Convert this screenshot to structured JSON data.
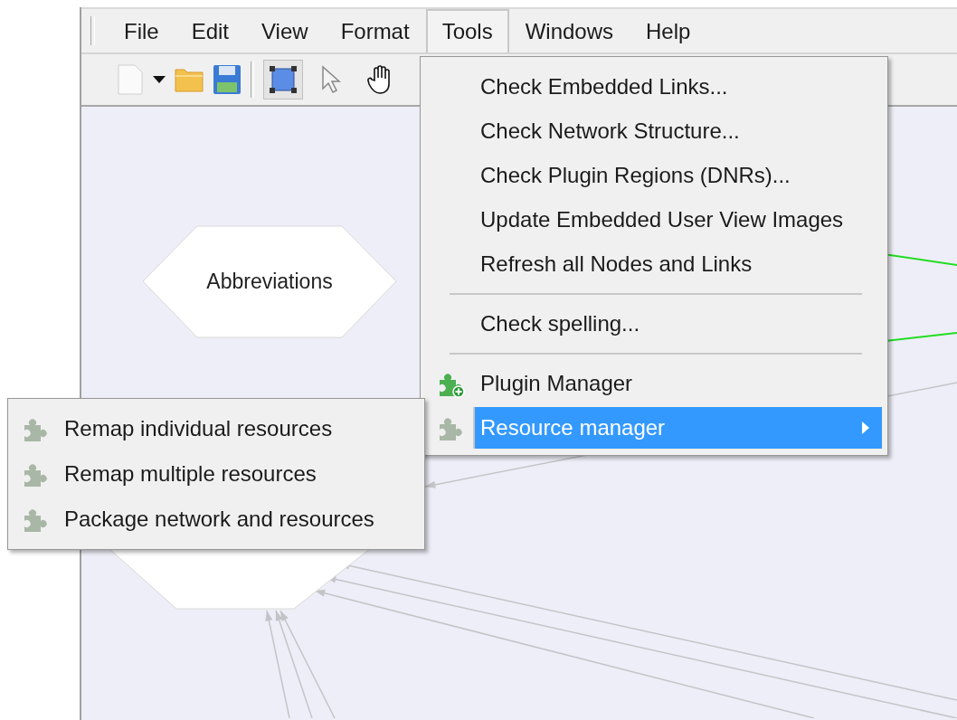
{
  "menubar": [
    {
      "label": "File",
      "selected": false
    },
    {
      "label": "Edit",
      "selected": false
    },
    {
      "label": "View",
      "selected": false
    },
    {
      "label": "Format",
      "selected": false
    },
    {
      "label": "Tools",
      "selected": true
    },
    {
      "label": "Windows",
      "selected": false
    },
    {
      "label": "Help",
      "selected": false
    }
  ],
  "toolbar": [
    {
      "kind": "new"
    },
    {
      "kind": "caret"
    },
    {
      "kind": "open"
    },
    {
      "kind": "save"
    },
    {
      "kind": "separator"
    },
    {
      "kind": "rect-select",
      "selected": true
    },
    {
      "kind": "pointer",
      "selected": false
    },
    {
      "kind": "hand",
      "selected": false
    }
  ],
  "canvas": {
    "nodes": [
      {
        "label": "Abbreviations",
        "kind": "hexagon"
      }
    ]
  },
  "tools_menu": [
    {
      "kind": "item",
      "label": "Check Embedded Links...",
      "selected": false
    },
    {
      "kind": "item",
      "label": "Check Network Structure...",
      "selected": false
    },
    {
      "kind": "item",
      "label": "Check Plugin Regions (DNRs)...",
      "selected": false
    },
    {
      "kind": "item",
      "label": "Update Embedded User View Images",
      "selected": false
    },
    {
      "kind": "item",
      "label": "Refresh all Nodes and Links",
      "selected": false
    },
    {
      "kind": "separator"
    },
    {
      "kind": "item",
      "label": "Check spelling...",
      "selected": false
    },
    {
      "kind": "separator"
    },
    {
      "kind": "plugin",
      "label": "Plugin Manager",
      "selected": false
    },
    {
      "kind": "submenu",
      "label": "Resource manager",
      "selected": true
    }
  ],
  "resource_submenu": [
    {
      "label": "Remap individual resources"
    },
    {
      "label": "Remap multiple resources"
    },
    {
      "label": "Package network and resources"
    }
  ]
}
